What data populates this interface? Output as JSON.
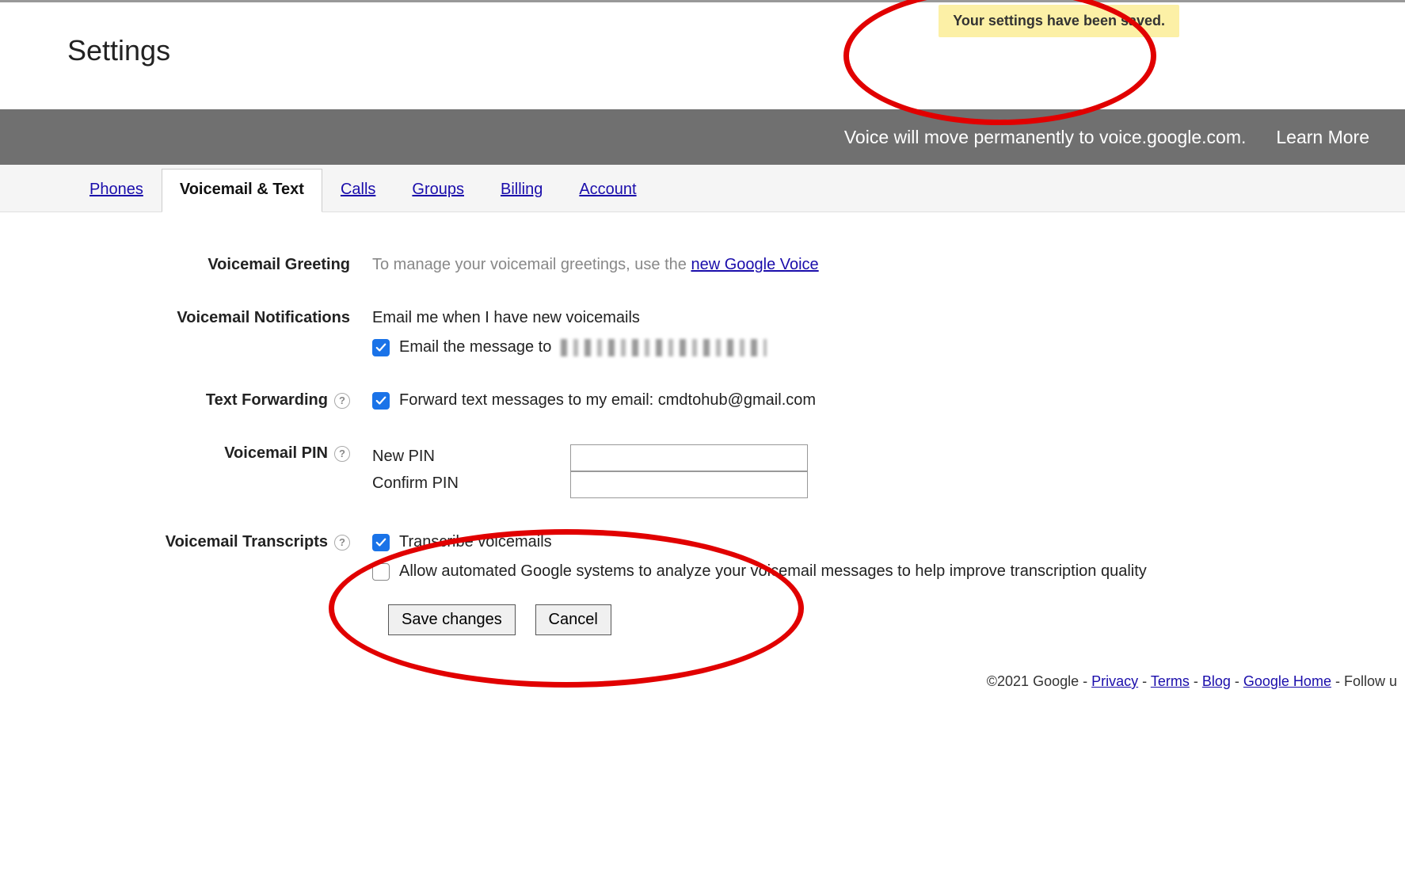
{
  "page_title": "Settings",
  "toast": "Your settings have been saved.",
  "banner": {
    "message": "Voice will move permanently to voice.google.com.",
    "learn_more": "Learn More"
  },
  "tabs": {
    "phones": "Phones",
    "voicemail_text": "Voicemail & Text",
    "calls": "Calls",
    "groups": "Groups",
    "billing": "Billing",
    "account": "Account"
  },
  "sections": {
    "greeting": {
      "label": "Voicemail Greeting",
      "text": "To manage your voicemail greetings, use the ",
      "link": "new Google Voice"
    },
    "notifications": {
      "label": "Voicemail Notifications",
      "text": "Email me when I have new voicemails",
      "checkbox_label_prefix": "Email the message to"
    },
    "text_forwarding": {
      "label": "Text Forwarding",
      "checkbox_label": "Forward text messages to my email: cmdtohub@gmail.com"
    },
    "pin": {
      "label": "Voicemail PIN",
      "new_pin": "New PIN",
      "confirm_pin": "Confirm PIN"
    },
    "transcripts": {
      "label": "Voicemail Transcripts",
      "transcribe": "Transcribe voicemails",
      "allow_analyze": "Allow automated Google systems to analyze your voicemail messages to help improve transcription quality"
    }
  },
  "buttons": {
    "save": "Save changes",
    "cancel": "Cancel"
  },
  "footer": {
    "copyright": "©2021 Google - ",
    "privacy": "Privacy",
    "terms": "Terms",
    "blog": "Blog",
    "google_home": "Google Home",
    "follow": " - Follow u",
    "sep": " - "
  }
}
